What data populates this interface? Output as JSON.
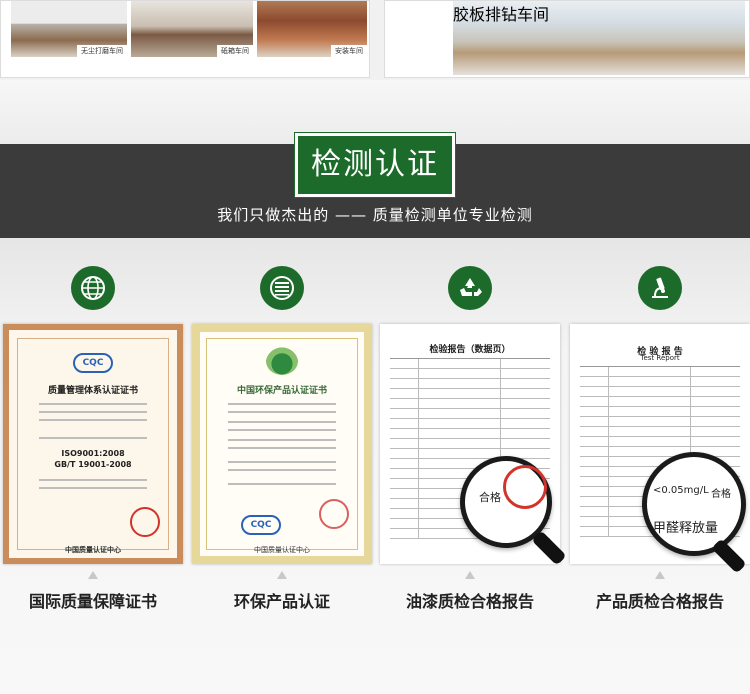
{
  "top_strip": {
    "photo_captions": [
      "无尘打磨车间",
      "砥箱车间",
      "安装车间",
      "胶板排钻车间"
    ]
  },
  "section": {
    "title": "检测认证",
    "subtitle": "我们只做杰出的  ——  质量检测单位专业检测"
  },
  "certificates": [
    {
      "icon": "globe-icon",
      "caption": "国际质量保障证书",
      "doc_title": "质量管理体系认证证书",
      "doc_lines": [
        "ISO9001:2008",
        "GB/T 19001-2008"
      ],
      "doc_footer": "中国质量认证中心"
    },
    {
      "icon": "flag-icon",
      "caption": "环保产品认证",
      "doc_title": "中国环保产品认证证书",
      "doc_footer": "中国质量认证中心"
    },
    {
      "icon": "recycle-icon",
      "caption": "油漆质检合格报告",
      "doc_title": "检验报告（数据页）",
      "magnifier_text": "合格"
    },
    {
      "icon": "microscope-icon",
      "caption": "产品质检合格报告",
      "doc_title": "检 验 报 告",
      "doc_subtitle": "Test Report",
      "magnifier_text": "<0.05mg/L",
      "magnifier_text_2": "合格",
      "magnifier_label": "甲醛释放量"
    }
  ],
  "colors": {
    "brand_green": "#1d6b2a",
    "dark_band": "#3b3b3b"
  }
}
